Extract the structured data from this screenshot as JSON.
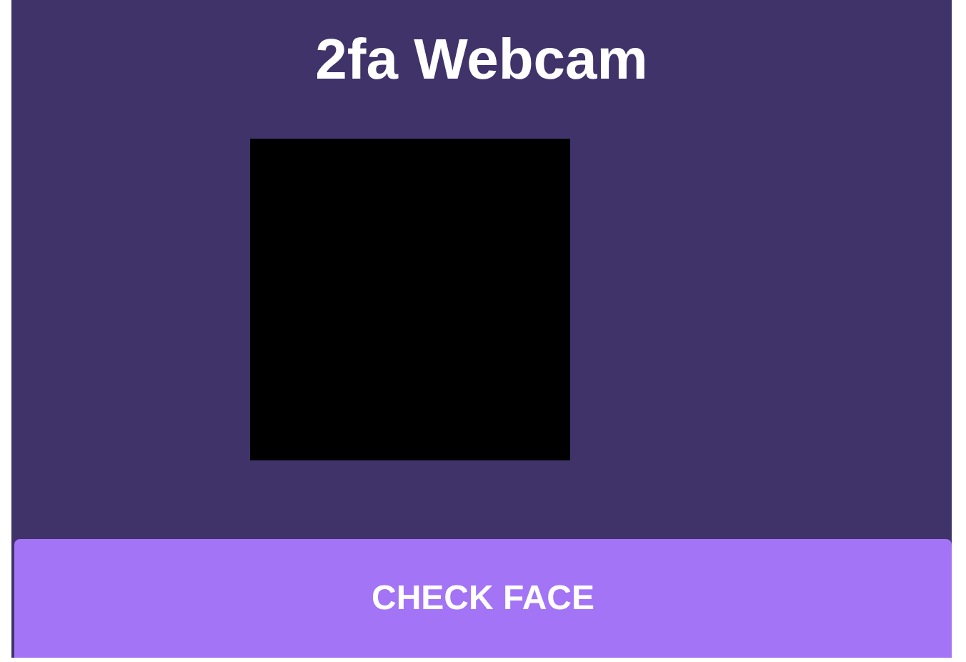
{
  "title": "2fa Webcam",
  "webcam": {
    "kind": "blank"
  },
  "button": {
    "label": "CHECK FACE"
  }
}
